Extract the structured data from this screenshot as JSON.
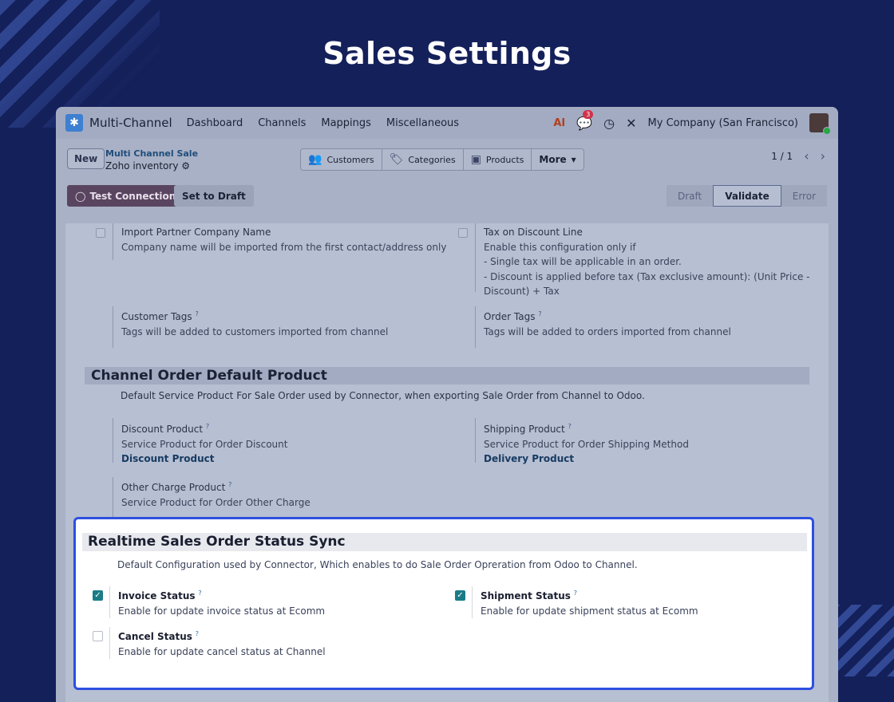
{
  "banner": {
    "title": "Sales Settings"
  },
  "navbar": {
    "app_name": "Multi-Channel",
    "menu": [
      "Dashboard",
      "Channels",
      "Mappings",
      "Miscellaneous"
    ],
    "ai_label": "AI",
    "chat_count": "3",
    "company": "My Company (San Francisco)"
  },
  "control_panel": {
    "new_label": "New",
    "breadcrumb_parent": "Multi Channel Sale",
    "breadcrumb_current": "Zoho inventory",
    "smart_buttons": [
      "Customers",
      "Categories",
      "Products",
      "More"
    ],
    "pager": "1 / 1"
  },
  "status_row": {
    "test_connection": "Test Connection",
    "set_to_draft": "Set to Draft",
    "stages": [
      "Draft",
      "Validate",
      "Error"
    ],
    "active_stage": "Validate"
  },
  "form": {
    "import_partner": {
      "label": "Import Partner Company Name",
      "desc": "Company name will be imported from the first contact/address only"
    },
    "tax_discount": {
      "label": "Tax on Discount Line",
      "desc1": "Enable this configuration only if",
      "desc2": "- Single tax will be applicable in an order.",
      "desc3": "- Discount is applied before tax (Tax exclusive amount): (Unit Price -",
      "desc4": "Discount) + Tax"
    },
    "customer_tags": {
      "label": "Customer Tags",
      "desc": "Tags will be added to customers imported from channel"
    },
    "order_tags": {
      "label": "Order Tags",
      "desc": "Tags will be added to orders imported from channel"
    },
    "default_product": {
      "title": "Channel Order Default Product",
      "desc": "Default Service Product For Sale Order used by Connector, when exporting Sale Order from Channel to Odoo.",
      "discount": {
        "label": "Discount Product",
        "desc": "Service Product for Order Discount",
        "value": "Discount Product"
      },
      "shipping": {
        "label": "Shipping Product",
        "desc": "Service Product for Order Shipping Method",
        "value": "Delivery Product"
      },
      "other": {
        "label": "Other Charge Product",
        "desc": "Service Product for Order Other Charge"
      }
    },
    "help_mark": "?"
  },
  "status_sync": {
    "title": "Realtime Sales Order Status Sync",
    "desc": "Default Configuration used by Connector, Which enables to do Sale Order Opreration from Odoo to Channel.",
    "invoice": {
      "label": "Invoice Status",
      "desc": "Enable for update invoice status at Ecomm",
      "checked": true
    },
    "shipment": {
      "label": "Shipment Status",
      "desc": "Enable for update shipment status at Ecomm",
      "checked": true
    },
    "cancel": {
      "label": "Cancel Status",
      "desc": "Enable for update cancel status at Channel",
      "checked": false
    }
  },
  "colors": {
    "background": "#14205a",
    "highlight_border": "#2d4fe0",
    "checkbox_checked": "#1a7c86",
    "primary_button": "#5a4560"
  }
}
